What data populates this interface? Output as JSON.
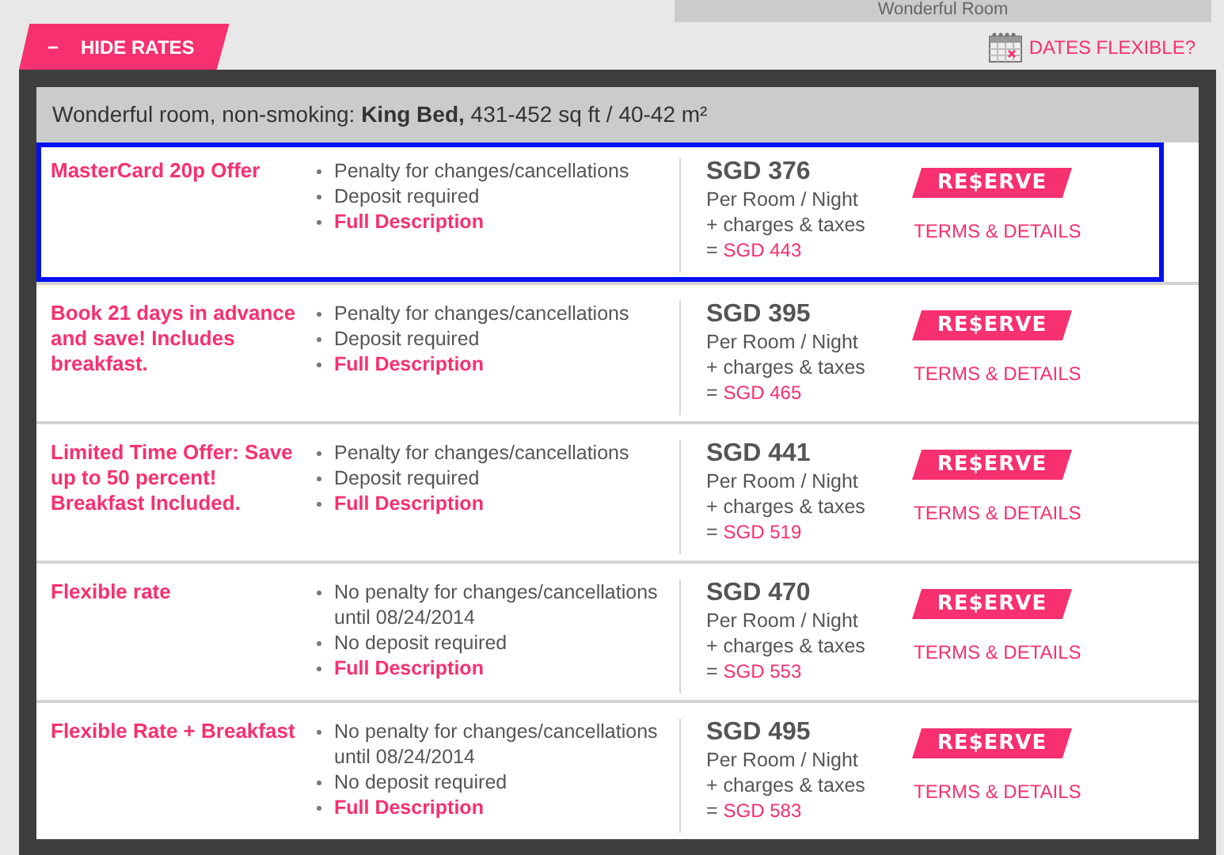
{
  "room_tab": {
    "label": "Wonderful Room"
  },
  "toggle": {
    "icon": "−",
    "label": "HIDE RATES",
    "expanded": true
  },
  "dates_flexible": {
    "label": "DATES FLEXIBLE?"
  },
  "room_header": {
    "text": "Wonderful room, non-smoking: **King Bed,** 431-452 sq ft / 40-42 m²"
  },
  "rates": [
    {
      "name": "MasterCard 20p Offer",
      "selected": true,
      "policies": [
        {
          "kind": "text",
          "text": "Penalty for changes/cancellations"
        },
        {
          "kind": "text",
          "text": "Deposit required"
        },
        {
          "kind": "link",
          "text": "Full Description"
        }
      ],
      "price": "SGD 376",
      "unit": "Per Room / Night",
      "charges": "+ charges & taxes",
      "equals": "=",
      "total": "SGD 443",
      "reserve": "RE$ERVE",
      "terms": "TERMS & DETAILS"
    },
    {
      "name": "Book 21 days in advance and save! Includes breakfast.",
      "selected": false,
      "policies": [
        {
          "kind": "text",
          "text": "Penalty for changes/cancellations"
        },
        {
          "kind": "text",
          "text": "Deposit required"
        },
        {
          "kind": "link",
          "text": "Full Description"
        }
      ],
      "price": "SGD 395",
      "unit": "Per Room / Night",
      "charges": "+ charges & taxes",
      "equals": "=",
      "total": "SGD 465",
      "reserve": "RE$ERVE",
      "terms": "TERMS & DETAILS"
    },
    {
      "name": "Limited Time Offer: Save up to 50 percent! Breakfast Included.",
      "selected": false,
      "policies": [
        {
          "kind": "text",
          "text": "Penalty for changes/cancellations"
        },
        {
          "kind": "text",
          "text": "Deposit required"
        },
        {
          "kind": "link",
          "text": "Full Description"
        }
      ],
      "price": "SGD 441",
      "unit": "Per Room / Night",
      "charges": "+ charges & taxes",
      "equals": "=",
      "total": "SGD 519",
      "reserve": "RE$ERVE",
      "terms": "TERMS & DETAILS"
    },
    {
      "name": "Flexible rate",
      "selected": false,
      "policies": [
        {
          "kind": "text",
          "text": "No penalty for changes/cancellations until 08/24/2014"
        },
        {
          "kind": "text",
          "text": "No deposit required"
        },
        {
          "kind": "link",
          "text": "Full Description"
        }
      ],
      "price": "SGD 470",
      "unit": "Per Room / Night",
      "charges": "+ charges & taxes",
      "equals": "=",
      "total": "SGD 553",
      "reserve": "RE$ERVE",
      "terms": "TERMS & DETAILS"
    },
    {
      "name": "Flexible Rate + Breakfast",
      "selected": false,
      "policies": [
        {
          "kind": "text",
          "text": "No penalty for changes/cancellations until 08/24/2014"
        },
        {
          "kind": "text",
          "text": "No deposit required"
        },
        {
          "kind": "link",
          "text": "Full Description"
        }
      ],
      "price": "SGD 495",
      "unit": "Per Room / Night",
      "charges": "+ charges & taxes",
      "equals": "=",
      "total": "SGD 583",
      "reserve": "RE$ERVE",
      "terms": "TERMS & DETAILS"
    }
  ]
}
